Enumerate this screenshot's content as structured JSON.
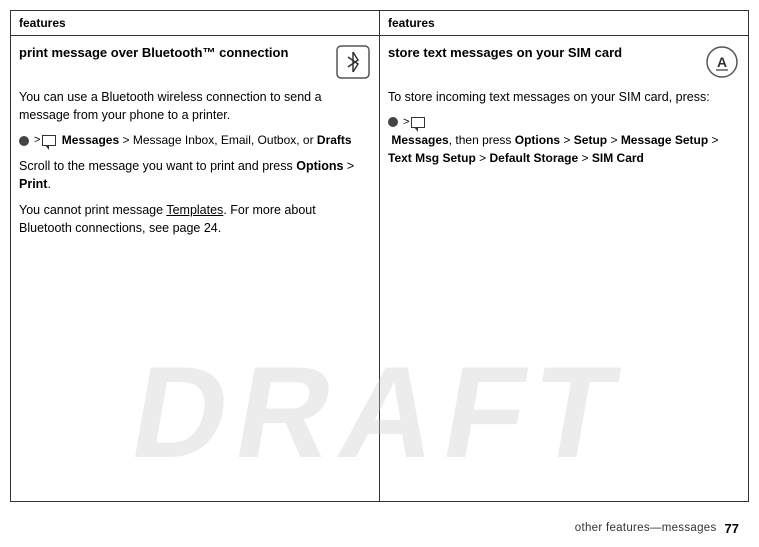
{
  "page": {
    "draft_watermark": "DRAFT",
    "footer": {
      "text": "other features—messages",
      "page_number": "77"
    }
  },
  "left_column": {
    "header": "features",
    "title": "print message over Bluetooth™ connection",
    "paragraphs": [
      "You can use a Bluetooth wireless connection to send a message from your phone to a printer.",
      "Scroll to the message you want to print and press Options > Print.",
      "You cannot print message Templates. For more about Bluetooth connections, see page 24."
    ],
    "nav_instruction": "> Messages > Message Inbox, Email, Outbox, or Drafts"
  },
  "right_column": {
    "header": "features",
    "title": "store text messages on your SIM card",
    "intro": "To store incoming text messages on your SIM card, press:",
    "nav_path": "> Messages, then press Options > Setup > Message Setup > Text Msg Setup > Default Storage > SIM Card"
  }
}
